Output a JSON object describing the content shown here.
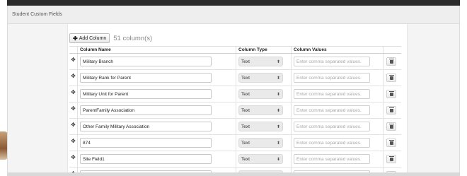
{
  "window": {
    "title": "Student Custom Fields"
  },
  "toolbar": {
    "add_label": "Add Column",
    "count_text": "51 column(s)"
  },
  "table": {
    "headers": {
      "name": "Column Name",
      "type": "Column Type",
      "values": "Column Values"
    },
    "values_placeholder": "Enter comma separated values.",
    "rows": [
      {
        "name": "Military Branch",
        "type": "Text"
      },
      {
        "name": "Military Rank for Parent",
        "type": "Text"
      },
      {
        "name": "Military Unit for Parent",
        "type": "Text"
      },
      {
        "name": "ParentFamily Association",
        "type": "Text"
      },
      {
        "name": "Other Family Military Association",
        "type": "Text"
      },
      {
        "name": "874",
        "type": "Text"
      },
      {
        "name": "Site Field1",
        "type": "Text"
      },
      {
        "name": "",
        "type": ""
      }
    ]
  },
  "icons": {
    "drag": "move-icon",
    "delete": "trash-icon",
    "add": "plus-icon",
    "select": "updown-caret-icon"
  }
}
